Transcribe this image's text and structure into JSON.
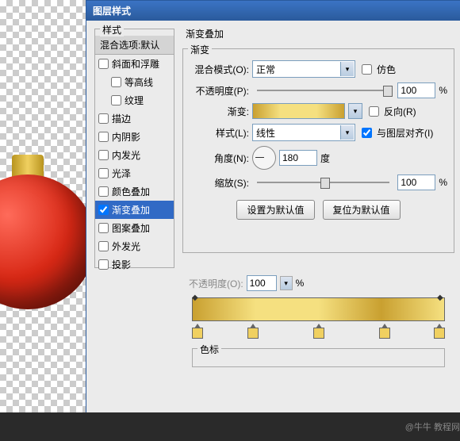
{
  "dialog_title": "图层样式",
  "left": {
    "styles_title": "样式",
    "blend_options": "混合选项:默认",
    "items": [
      {
        "label": "斜面和浮雕",
        "checked": false,
        "indent": false
      },
      {
        "label": "等高线",
        "checked": false,
        "indent": true
      },
      {
        "label": "纹理",
        "checked": false,
        "indent": true
      },
      {
        "label": "描边",
        "checked": false,
        "indent": false
      },
      {
        "label": "内阴影",
        "checked": false,
        "indent": false
      },
      {
        "label": "内发光",
        "checked": false,
        "indent": false
      },
      {
        "label": "光泽",
        "checked": false,
        "indent": false
      },
      {
        "label": "颜色叠加",
        "checked": false,
        "indent": false
      },
      {
        "label": "渐变叠加",
        "checked": true,
        "indent": false,
        "active": true
      },
      {
        "label": "图案叠加",
        "checked": false,
        "indent": false
      },
      {
        "label": "外发光",
        "checked": false,
        "indent": false
      },
      {
        "label": "投影",
        "checked": false,
        "indent": false
      }
    ]
  },
  "right": {
    "section_title": "渐变叠加",
    "gradient_group": "渐变",
    "blend_mode_label": "混合模式(O):",
    "blend_mode_value": "正常",
    "dither_label": "仿色",
    "opacity_label": "不透明度(P):",
    "opacity_value": "100",
    "percent": "%",
    "gradient_label": "渐变:",
    "reverse_label": "反向(R)",
    "style_label": "样式(L):",
    "style_value": "线性",
    "align_label": "与图层对齐(I)",
    "angle_label": "角度(N):",
    "angle_value": "180",
    "degree": "度",
    "scale_label": "缩放(S):",
    "scale_value": "100",
    "btn_default": "设置为默认值",
    "btn_reset": "复位为默认值"
  },
  "lower": {
    "opacity_label_2": "不透明度(O):",
    "opacity_value_2": "100",
    "color_section": "色标"
  },
  "watermark": "@牛牛 教程网"
}
